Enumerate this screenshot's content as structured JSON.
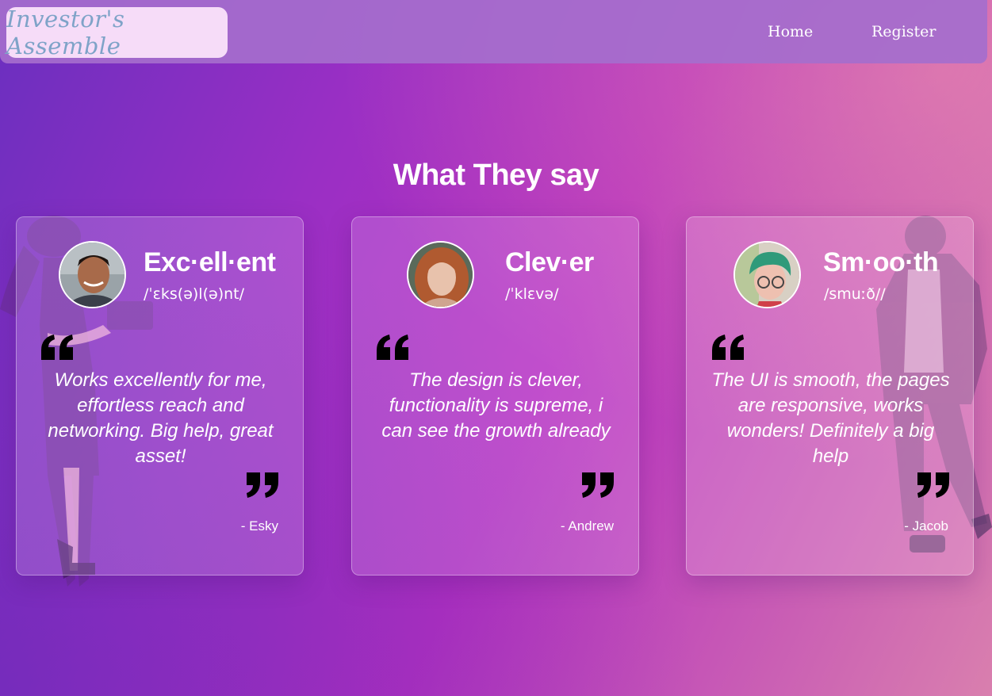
{
  "nav": {
    "logo_text": "Investor's Assemble",
    "links": [
      {
        "label": "Home"
      },
      {
        "label": "Register"
      }
    ]
  },
  "section": {
    "title": "What They say"
  },
  "testimonials": [
    {
      "word": "Exc·ell·ent",
      "phonetic": "/ˈɛks(ə)l(ə)nt/",
      "quote": "Works excellently for me, effortless reach and networking. Big help, great asset!",
      "author": "- Esky"
    },
    {
      "word": "Clev·er",
      "phonetic": "/ˈklɛvə/",
      "quote": "The design is clever, functionality is supreme, i can see the growth already",
      "author": "- Andrew"
    },
    {
      "word": "Sm·oo·th",
      "phonetic": "/smuːð//",
      "quote": "The UI is smooth, the pages are responsive, works wonders! Definitely a big help",
      "author": "- Jacob"
    }
  ],
  "colors": {
    "nav_bg": "#a56ecd",
    "logo_bg": "#f6dcf8",
    "logo_text": "#7fa3c8",
    "text": "#ffffff",
    "quote_mark": "#000000"
  }
}
